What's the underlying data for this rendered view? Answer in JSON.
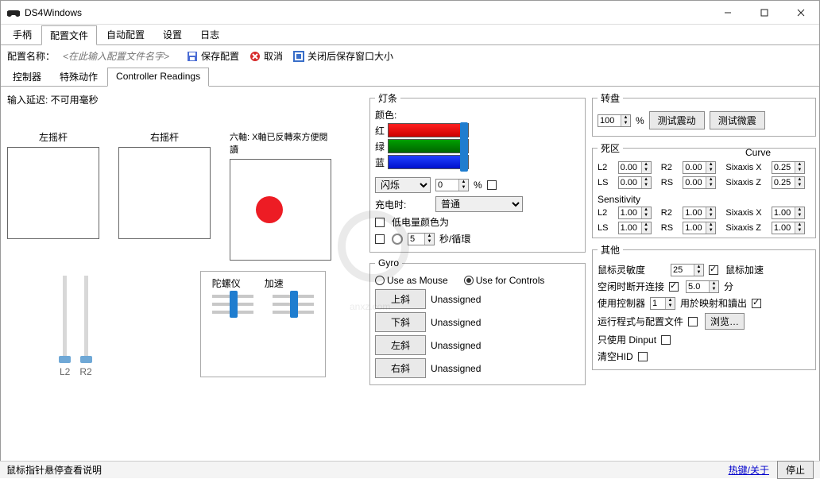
{
  "window": {
    "title": "DS4Windows"
  },
  "menutabs": [
    "手柄",
    "配置文件",
    "自动配置",
    "设置",
    "日志"
  ],
  "menutab_active": 1,
  "toolbar": {
    "profile_label": "配置名称：",
    "profile_placeholder": "<在此输入配置文件名字>",
    "save": "保存配置",
    "cancel": "取消",
    "keep_size": "关闭后保存窗口大小"
  },
  "subtabs": [
    "控制器",
    "特殊动作",
    "Controller Readings"
  ],
  "subtab_active": 2,
  "readings": {
    "input_delay": "输入延迟: 不可用毫秒",
    "left_stick": "左摇杆",
    "right_stick": "右摇杆",
    "sixaxis": "六軸: X軸已反轉來方便閱讀",
    "l2": "L2",
    "r2": "R2",
    "gyro_label": "陀螺仪",
    "accel_label": "加速"
  },
  "lightbar": {
    "title": "灯条",
    "color_label": "颜色:",
    "r": "红",
    "g": "绿",
    "b": "蓝",
    "flash_label": "闪烁",
    "flash_value": "0",
    "pct": "%",
    "charging_label": "充电时:",
    "charging_mode": "普通",
    "low_batt": "低电量颜色为",
    "sec_loop": "秒/循環",
    "sec_value": "5"
  },
  "gyro": {
    "title": "Gyro",
    "use_mouse": "Use as Mouse",
    "use_controls": "Use for Controls",
    "up": "上斜",
    "down": "下斜",
    "left": "左斜",
    "right": "右斜",
    "unassigned": "Unassigned"
  },
  "rumble": {
    "title": "转盘",
    "value": "100",
    "pct": "%",
    "test_heavy": "测试震动",
    "test_light": "测试微震"
  },
  "deadzone": {
    "title": "死区",
    "curve": "Curve",
    "labels": {
      "l2": "L2",
      "r2": "R2",
      "ls": "LS",
      "rs": "RS",
      "sx": "Sixaxis X",
      "sz": "Sixaxis Z"
    },
    "vals_dz": {
      "l2": "0.00",
      "r2": "0.00",
      "ls": "0.00",
      "rs": "0.00",
      "sx": "0.25",
      "sz": "0.25"
    },
    "sens_title": "Sensitivity",
    "vals_sens": {
      "l2": "1.00",
      "r2": "1.00",
      "ls": "1.00",
      "rs": "1.00",
      "sx": "1.00",
      "sz": "1.00"
    }
  },
  "other": {
    "title": "其他",
    "mouse_sens": "鼠标灵敏度",
    "mouse_sens_val": "25",
    "mouse_accel": "鼠标加速",
    "idle_disc": "空闲时断开连接",
    "idle_val": "5.0",
    "minutes": "分",
    "use_controller": "使用控制器",
    "use_controller_val": "1",
    "for_mapping": "用於映射和讀出",
    "launch_with": "运行程式与配置文件",
    "browse": "浏览…",
    "dinput_only": "只使用 Dinput",
    "flush_hid": "清空HID"
  },
  "status": {
    "tip": "鼠标指针悬停查看说明",
    "hotkeys": "热键/关于",
    "stop": "停止"
  }
}
